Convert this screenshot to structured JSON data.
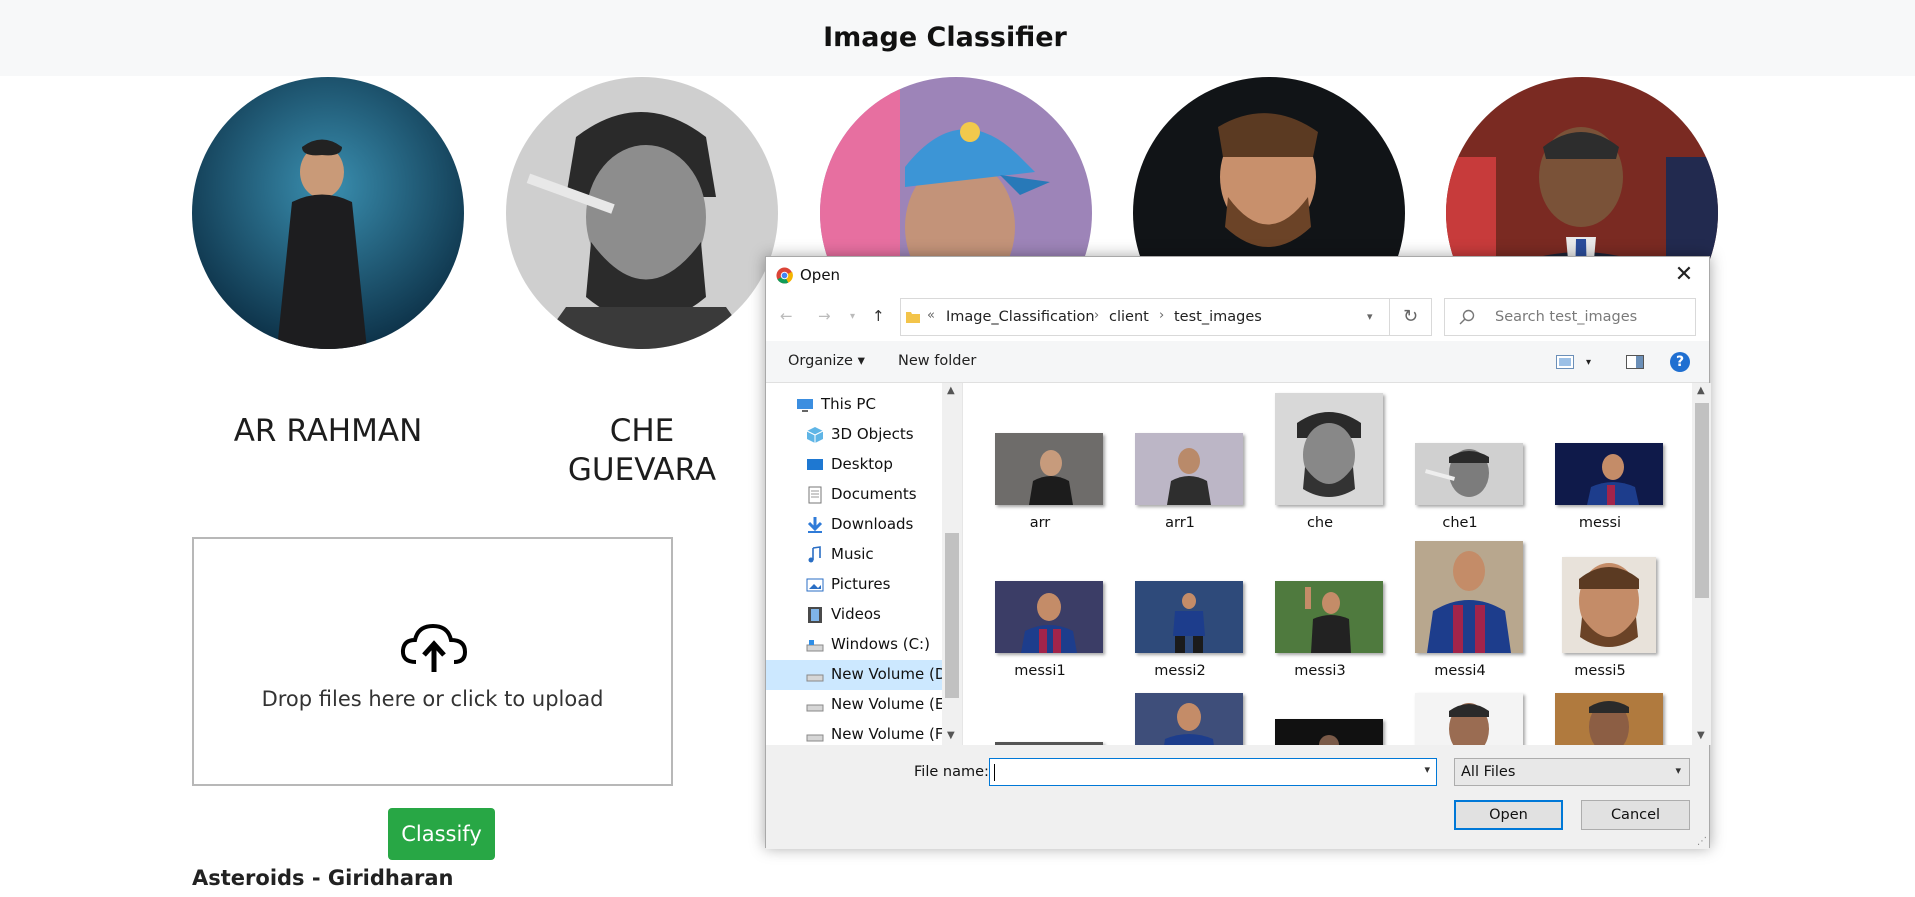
{
  "app": {
    "title": "Image Classifier"
  },
  "celebrities": [
    {
      "name": "AR RAHMAN"
    },
    {
      "name": "CHE GUEVARA"
    },
    {
      "name": ""
    },
    {
      "name": ""
    },
    {
      "name": ""
    }
  ],
  "upload": {
    "text": "Drop files here or click to upload"
  },
  "classify_label": "Classify",
  "footer": "Asteroids - Giridharan",
  "dialog": {
    "title": "Open",
    "breadcrumb_prefix": "«",
    "breadcrumb": [
      "Image_Classification",
      "client",
      "test_images"
    ],
    "search_placeholder": "Search test_images",
    "organize_label": "Organize ▾",
    "new_folder_label": "New folder",
    "nav_items": [
      {
        "label": "This PC",
        "icon": "computer-icon"
      },
      {
        "label": "3D Objects",
        "icon": "cube-icon"
      },
      {
        "label": "Desktop",
        "icon": "desktop-icon"
      },
      {
        "label": "Documents",
        "icon": "documents-icon"
      },
      {
        "label": "Downloads",
        "icon": "download-icon"
      },
      {
        "label": "Music",
        "icon": "music-icon"
      },
      {
        "label": "Pictures",
        "icon": "pictures-icon"
      },
      {
        "label": "Videos",
        "icon": "video-icon"
      },
      {
        "label": "Windows (C:)",
        "icon": "drive-icon"
      },
      {
        "label": "New Volume (D:)",
        "icon": "drive-icon",
        "selected": true
      },
      {
        "label": "New Volume (E:)",
        "icon": "drive-icon"
      },
      {
        "label": "New Volume (F:)",
        "icon": "drive-icon"
      }
    ],
    "files": [
      {
        "name": "arr"
      },
      {
        "name": "arr1"
      },
      {
        "name": "che"
      },
      {
        "name": "che1"
      },
      {
        "name": "messi"
      },
      {
        "name": "messi1"
      },
      {
        "name": "messi2"
      },
      {
        "name": "messi3"
      },
      {
        "name": "messi4"
      },
      {
        "name": "messi5"
      }
    ],
    "file_name_label": "File name:",
    "file_name_value": "",
    "filter_value": "All Files",
    "open_label": "Open",
    "cancel_label": "Cancel"
  },
  "colors": {
    "classify": "#28a745",
    "accent": "#0078d7",
    "nav_selected": "#cce8ff"
  }
}
